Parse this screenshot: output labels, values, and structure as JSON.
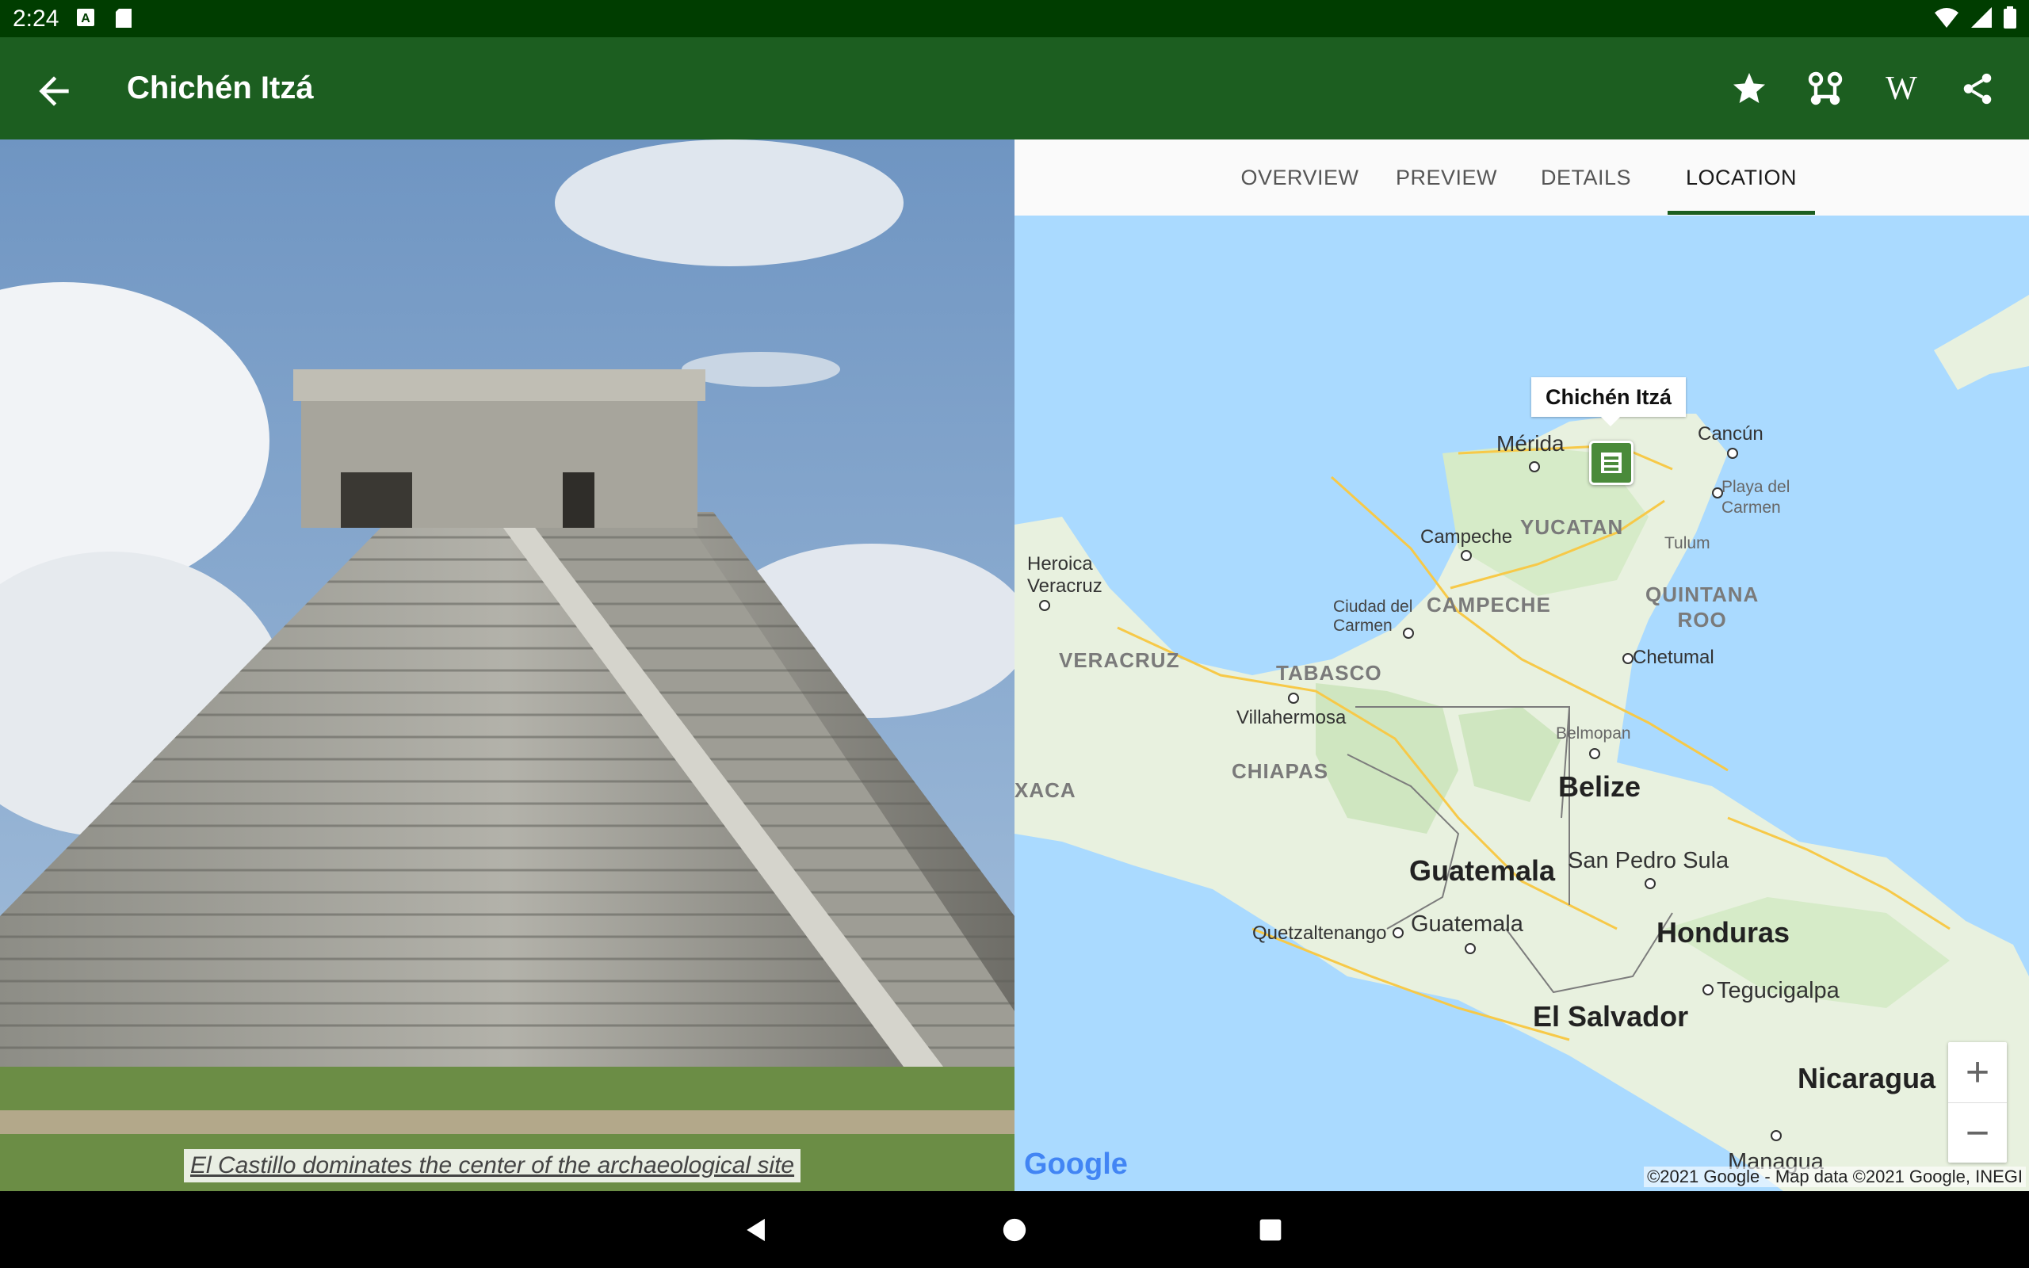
{
  "status_bar": {
    "time": "2:24",
    "icons": [
      "a-box-icon",
      "sd-card-icon",
      "wifi-icon",
      "signal-icon",
      "battery-icon"
    ]
  },
  "app_bar": {
    "title": "Chichén Itzá",
    "actions": [
      "star-icon",
      "route-icon",
      "wikipedia-icon",
      "share-icon"
    ],
    "wiki_glyph": "W"
  },
  "photo": {
    "caption": "El Castillo dominates the center of the archaeological site"
  },
  "tabs": [
    {
      "label": "OVERVIEW",
      "active": false
    },
    {
      "label": "PREVIEW",
      "active": false
    },
    {
      "label": "DETAILS",
      "active": false
    },
    {
      "label": "LOCATION",
      "active": true
    }
  ],
  "map": {
    "callout": "Chichén Itzá",
    "cities": {
      "merida": "Mérida",
      "cancun": "Cancún",
      "playa": "Playa del\nCarmen",
      "campeche": "Campeche",
      "tulum": "Tulum",
      "veracruz_city": "Heroica\nVeracruz",
      "ciudad_carmen": "Ciudad del\nCarmen",
      "chetumal": "Chetumal",
      "villahermosa": "Villahermosa",
      "belmopan": "Belmopan",
      "san_pedro": "San Pedro Sula",
      "quetzaltenango": "Quetzaltenango",
      "guatemala_city": "Guatemala",
      "tegucigalpa": "Tegucigalpa",
      "managua": "Managua"
    },
    "regions": {
      "yucatan": "YUCATAN",
      "campeche": "CAMPECHE",
      "quintana": "QUINTANA\nROO",
      "veracruz": "VERACRUZ",
      "tabasco": "TABASCO",
      "chiapas": "CHIAPAS",
      "oaxaca": "XACA"
    },
    "countries": {
      "belize": "Belize",
      "guatemala": "Guatemala",
      "honduras": "Honduras",
      "el_salvador": "El Salvador",
      "nicaragua": "Nicaragua"
    },
    "zoom_in": "+",
    "zoom_out": "−",
    "google_logo": "Google",
    "copyright": "©2021 Google - Map data ©2021 Google, INEGI"
  }
}
